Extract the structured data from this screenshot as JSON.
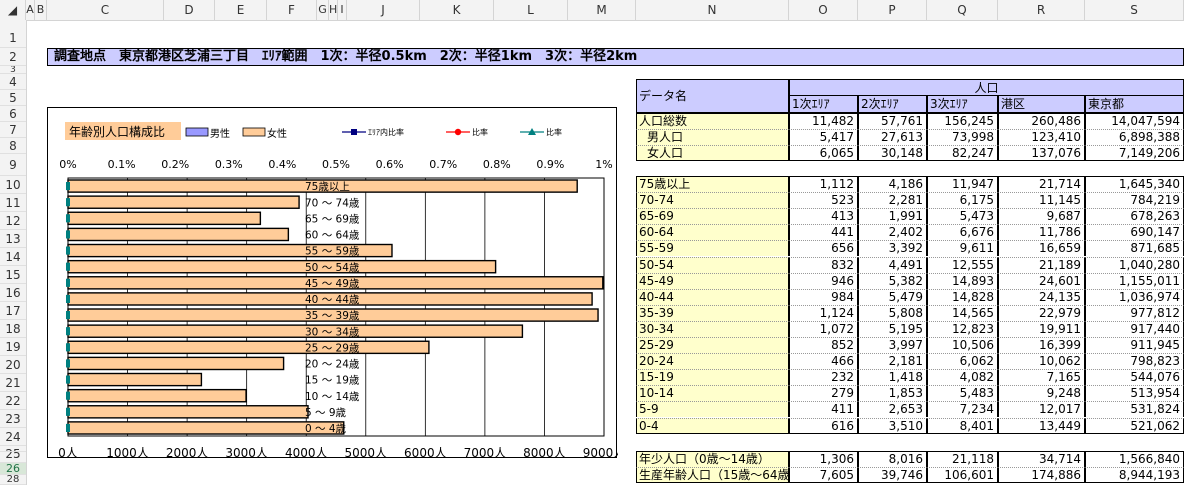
{
  "columns": [
    "A",
    "B",
    "C",
    "D",
    "E",
    "F",
    "G",
    "H",
    "I",
    "J",
    "K",
    "L",
    "M",
    "N",
    "O",
    "P",
    "Q",
    "R",
    "S"
  ],
  "rows": [
    "1",
    "2",
    "3",
    "4",
    "5",
    "6",
    "7",
    "8",
    "9",
    "10",
    "11",
    "12",
    "13",
    "14",
    "15",
    "16",
    "17",
    "18",
    "19",
    "20",
    "21",
    "22",
    "23",
    "24",
    "25",
    "26",
    "27",
    "28"
  ],
  "title": "調査地点　東京都港区芝浦三丁目　ｴﾘｱ範囲　1次：半径0.5km　2次：半径1km　3次：半径2km",
  "chart": {
    "title": "年齢別人口構成比",
    "legend": {
      "male": "男性",
      "female": "女性",
      "area_ratio": "ｴﾘｱ内比率",
      "ratio1": "比率",
      "ratio2": "比率"
    },
    "colors": {
      "male": "#9999ff",
      "female": "#ffcc99",
      "area_ratio": "#000080",
      "ratio1": "#ff0000",
      "ratio2": "#008080"
    }
  },
  "chart_data": {
    "type": "bar",
    "orientation": "horizontal",
    "title": "年齢別人口構成比",
    "categories": [
      "75歳以上",
      "70 ～ 74歳",
      "65 ～ 69歳",
      "60 ～ 64歳",
      "55 ～ 59歳",
      "50 ～ 54歳",
      "45 ～ 49歳",
      "40 ～ 44歳",
      "35 ～ 39歳",
      "30 ～ 34歳",
      "25 ～ 29歳",
      "20 ～ 24歳",
      "15 ～ 19歳",
      "10 ～ 14歳",
      "5 ～ 9歳",
      "0 ～ 4歳"
    ],
    "series": [
      {
        "name": "女性",
        "values": [
          8550,
          3880,
          3230,
          3700,
          5440,
          7180,
          8980,
          8800,
          8900,
          7630,
          6060,
          3620,
          2240,
          2990,
          4030,
          4630
        ]
      }
    ],
    "xlim": [
      0,
      9000
    ],
    "x_ticks_bottom": [
      "0人",
      "1000人",
      "2000人",
      "3000人",
      "4000人",
      "5000人",
      "6000人",
      "7000人",
      "8000人",
      "9000人"
    ],
    "x_ticks_top": [
      "0%",
      "0.1%",
      "0.2%",
      "0.3%",
      "0.4%",
      "0.5%",
      "0.6%",
      "0.7%",
      "0.8%",
      "0.9%",
      "1%"
    ],
    "grid": true
  },
  "table": {
    "header_name": "データ名",
    "header_group": "人口",
    "subheaders": [
      "1次ｴﾘｱ",
      "2次ｴﾘｱ",
      "3次ｴﾘｱ",
      "港区",
      "東京都"
    ],
    "block1": [
      {
        "label": "人口総数",
        "values": [
          "11,482",
          "57,761",
          "156,245",
          "260,486",
          "14,047,594"
        ]
      },
      {
        "label": "男人口",
        "values": [
          "5,417",
          "27,613",
          "73,998",
          "123,410",
          "6,898,388"
        ]
      },
      {
        "label": "女人口",
        "values": [
          "6,065",
          "30,148",
          "82,247",
          "137,076",
          "7,149,206"
        ]
      }
    ],
    "block2": [
      {
        "label": "75歳以上",
        "values": [
          "1,112",
          "4,186",
          "11,947",
          "21,714",
          "1,645,340"
        ]
      },
      {
        "label": "70-74",
        "values": [
          "523",
          "2,281",
          "6,175",
          "11,145",
          "784,219"
        ]
      },
      {
        "label": "65-69",
        "values": [
          "413",
          "1,991",
          "5,473",
          "9,687",
          "678,263"
        ]
      },
      {
        "label": "60-64",
        "values": [
          "441",
          "2,402",
          "6,676",
          "11,786",
          "690,147"
        ]
      },
      {
        "label": "55-59",
        "values": [
          "656",
          "3,392",
          "9,611",
          "16,659",
          "871,685"
        ]
      },
      {
        "label": "50-54",
        "values": [
          "832",
          "4,491",
          "12,555",
          "21,189",
          "1,040,280"
        ]
      },
      {
        "label": "45-49",
        "values": [
          "946",
          "5,382",
          "14,893",
          "24,601",
          "1,155,011"
        ]
      },
      {
        "label": "40-44",
        "values": [
          "984",
          "5,479",
          "14,828",
          "24,135",
          "1,036,974"
        ]
      },
      {
        "label": "35-39",
        "values": [
          "1,124",
          "5,808",
          "14,565",
          "22,979",
          "977,812"
        ]
      },
      {
        "label": "30-34",
        "values": [
          "1,072",
          "5,195",
          "12,823",
          "19,911",
          "917,440"
        ]
      },
      {
        "label": "25-29",
        "values": [
          "852",
          "3,997",
          "10,506",
          "16,399",
          "911,945"
        ]
      },
      {
        "label": "20-24",
        "values": [
          "466",
          "2,181",
          "6,062",
          "10,062",
          "798,823"
        ]
      },
      {
        "label": "15-19",
        "values": [
          "232",
          "1,418",
          "4,082",
          "7,165",
          "544,076"
        ]
      },
      {
        "label": "10-14",
        "values": [
          "279",
          "1,853",
          "5,483",
          "9,248",
          "513,954"
        ]
      },
      {
        "label": "5-9",
        "values": [
          "411",
          "2,653",
          "7,234",
          "12,017",
          "531,824"
        ]
      },
      {
        "label": "0-4",
        "values": [
          "616",
          "3,510",
          "8,401",
          "13,449",
          "521,062"
        ]
      }
    ],
    "block3": [
      {
        "label": "年少人口（0歳～14歳）",
        "values": [
          "1,306",
          "8,016",
          "21,118",
          "34,714",
          "1,566,840"
        ]
      },
      {
        "label": "生産年齢人口（15歳～64歳）",
        "values": [
          "7,605",
          "39,746",
          "106,601",
          "174,886",
          "8,944,193"
        ]
      }
    ]
  }
}
